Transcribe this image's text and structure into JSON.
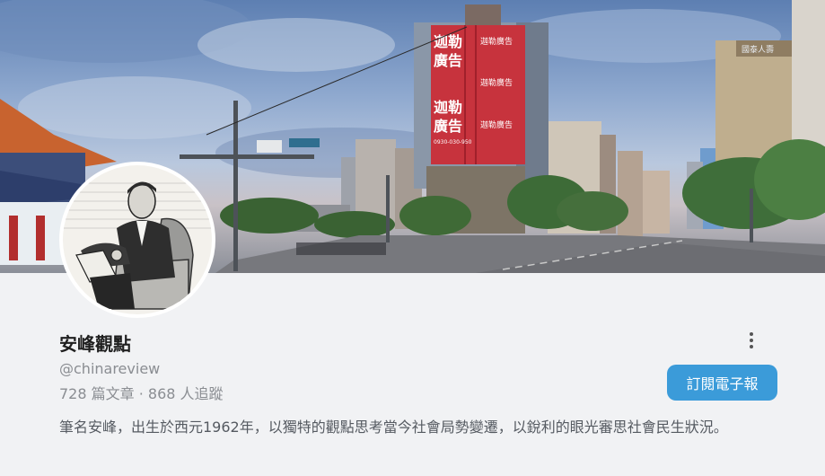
{
  "profile": {
    "name": "安峰觀點",
    "handle": "@chinareview",
    "stats": "728 篇文章 · 868 人追蹤",
    "bio": "筆名安峰，出生於西元1962年，以獨特的觀點思考當今社會局勢變遷，以銳利的眼光審思社會民生狀況。",
    "subscribe_label": "訂閱電子報"
  },
  "banner": {
    "billboard_big_1": "迦勒",
    "billboard_big_2": "廣告",
    "billboard_phone": "0930-030-950",
    "billboard_small": "迦勒廣告",
    "building_sign": "國泰人壽"
  },
  "icons": {
    "more": "more-vertical-icon"
  },
  "colors": {
    "accent": "#3b9bd9",
    "background": "#f1f2f4"
  }
}
